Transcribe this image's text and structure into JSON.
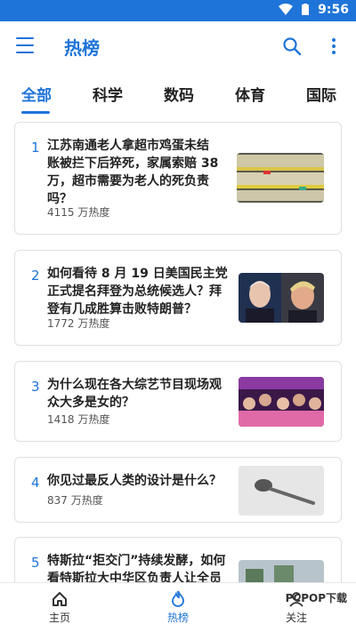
{
  "status": {
    "time": "9:56"
  },
  "header": {
    "title": "热榜"
  },
  "tabs": [
    {
      "label": "全部",
      "active": true
    },
    {
      "label": "科学"
    },
    {
      "label": "数码"
    },
    {
      "label": "体育"
    },
    {
      "label": "国际"
    }
  ],
  "items": [
    {
      "rank": "1",
      "title_lines": [
        "江苏南通老人拿超市鸡蛋未结",
        "账被拦下后猝死，家属索赔 38",
        "万，超市需要为老人的死负责",
        "吗？"
      ],
      "heat": "4115 万热度"
    },
    {
      "rank": "2",
      "title_lines": [
        "如何看待 8 月 19 日美国民主党",
        "正式提名拜登为总统候选人？拜",
        "登有几成胜算击败特朗普？"
      ],
      "heat": "1772 万热度"
    },
    {
      "rank": "3",
      "title_lines": [
        "为什么现在各大综艺节目现场观",
        "众大多是女的？"
      ],
      "heat": "1418 万热度"
    },
    {
      "rank": "4",
      "title_lines": [
        "你见过最反人类的设计是什么？"
      ],
      "heat": "837 万热度"
    },
    {
      "rank": "5",
      "title_lines": [
        "特斯拉“拒交门”持续发酵，如何",
        "看特斯拉大中华区负责人让全员"
      ],
      "heat": ""
    }
  ],
  "bottom_nav": [
    {
      "label": "主页",
      "icon": "home-icon"
    },
    {
      "label": "热榜",
      "icon": "flame-icon",
      "active": true
    },
    {
      "label": "关注",
      "icon": "follow-icon"
    }
  ],
  "watermark": "PCPOP下载",
  "colors": {
    "accent": "#1e74d8"
  }
}
